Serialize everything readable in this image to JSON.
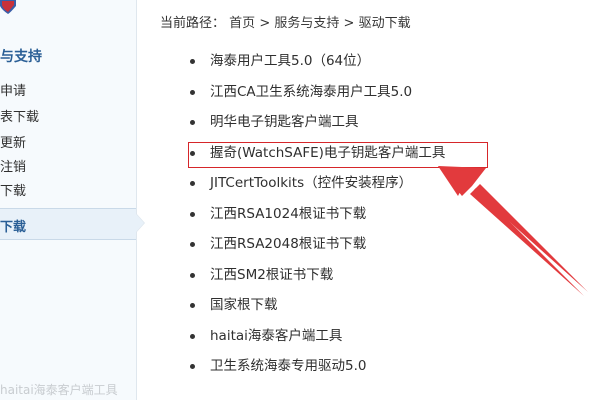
{
  "sidebar": {
    "title": "与支持",
    "items": [
      {
        "label": "申请"
      },
      {
        "label": "表下载"
      },
      {
        "label": "更新"
      },
      {
        "label": "注销"
      },
      {
        "label": "下载"
      }
    ],
    "active_label": "下载",
    "footer_faint": "haitai海泰客户端工具"
  },
  "breadcrumb": {
    "prefix": "当前路径：",
    "home": "首页",
    "sep1": ">",
    "section": "服务与支持",
    "sep2": ">",
    "current": "驱动下载"
  },
  "downloads": [
    {
      "label": "海泰用户工具5.0（64位）"
    },
    {
      "label": "江西CA卫生系统海泰用户工具5.0"
    },
    {
      "label": "明华电子钥匙客户端工具"
    },
    {
      "label": "握奇(WatchSAFE)电子钥匙客户端工具"
    },
    {
      "label": "JITCertToolkits（控件安装程序）"
    },
    {
      "label": "江西RSA1024根证书下载"
    },
    {
      "label": "江西RSA2048根证书下载"
    },
    {
      "label": "江西SM2根证书下载"
    },
    {
      "label": "国家根下载"
    },
    {
      "label": "haitai海泰客户端工具"
    },
    {
      "label": "卫生系统海泰专用驱动5.0"
    }
  ],
  "annotation": {
    "highlight_color": "#d6262a"
  }
}
